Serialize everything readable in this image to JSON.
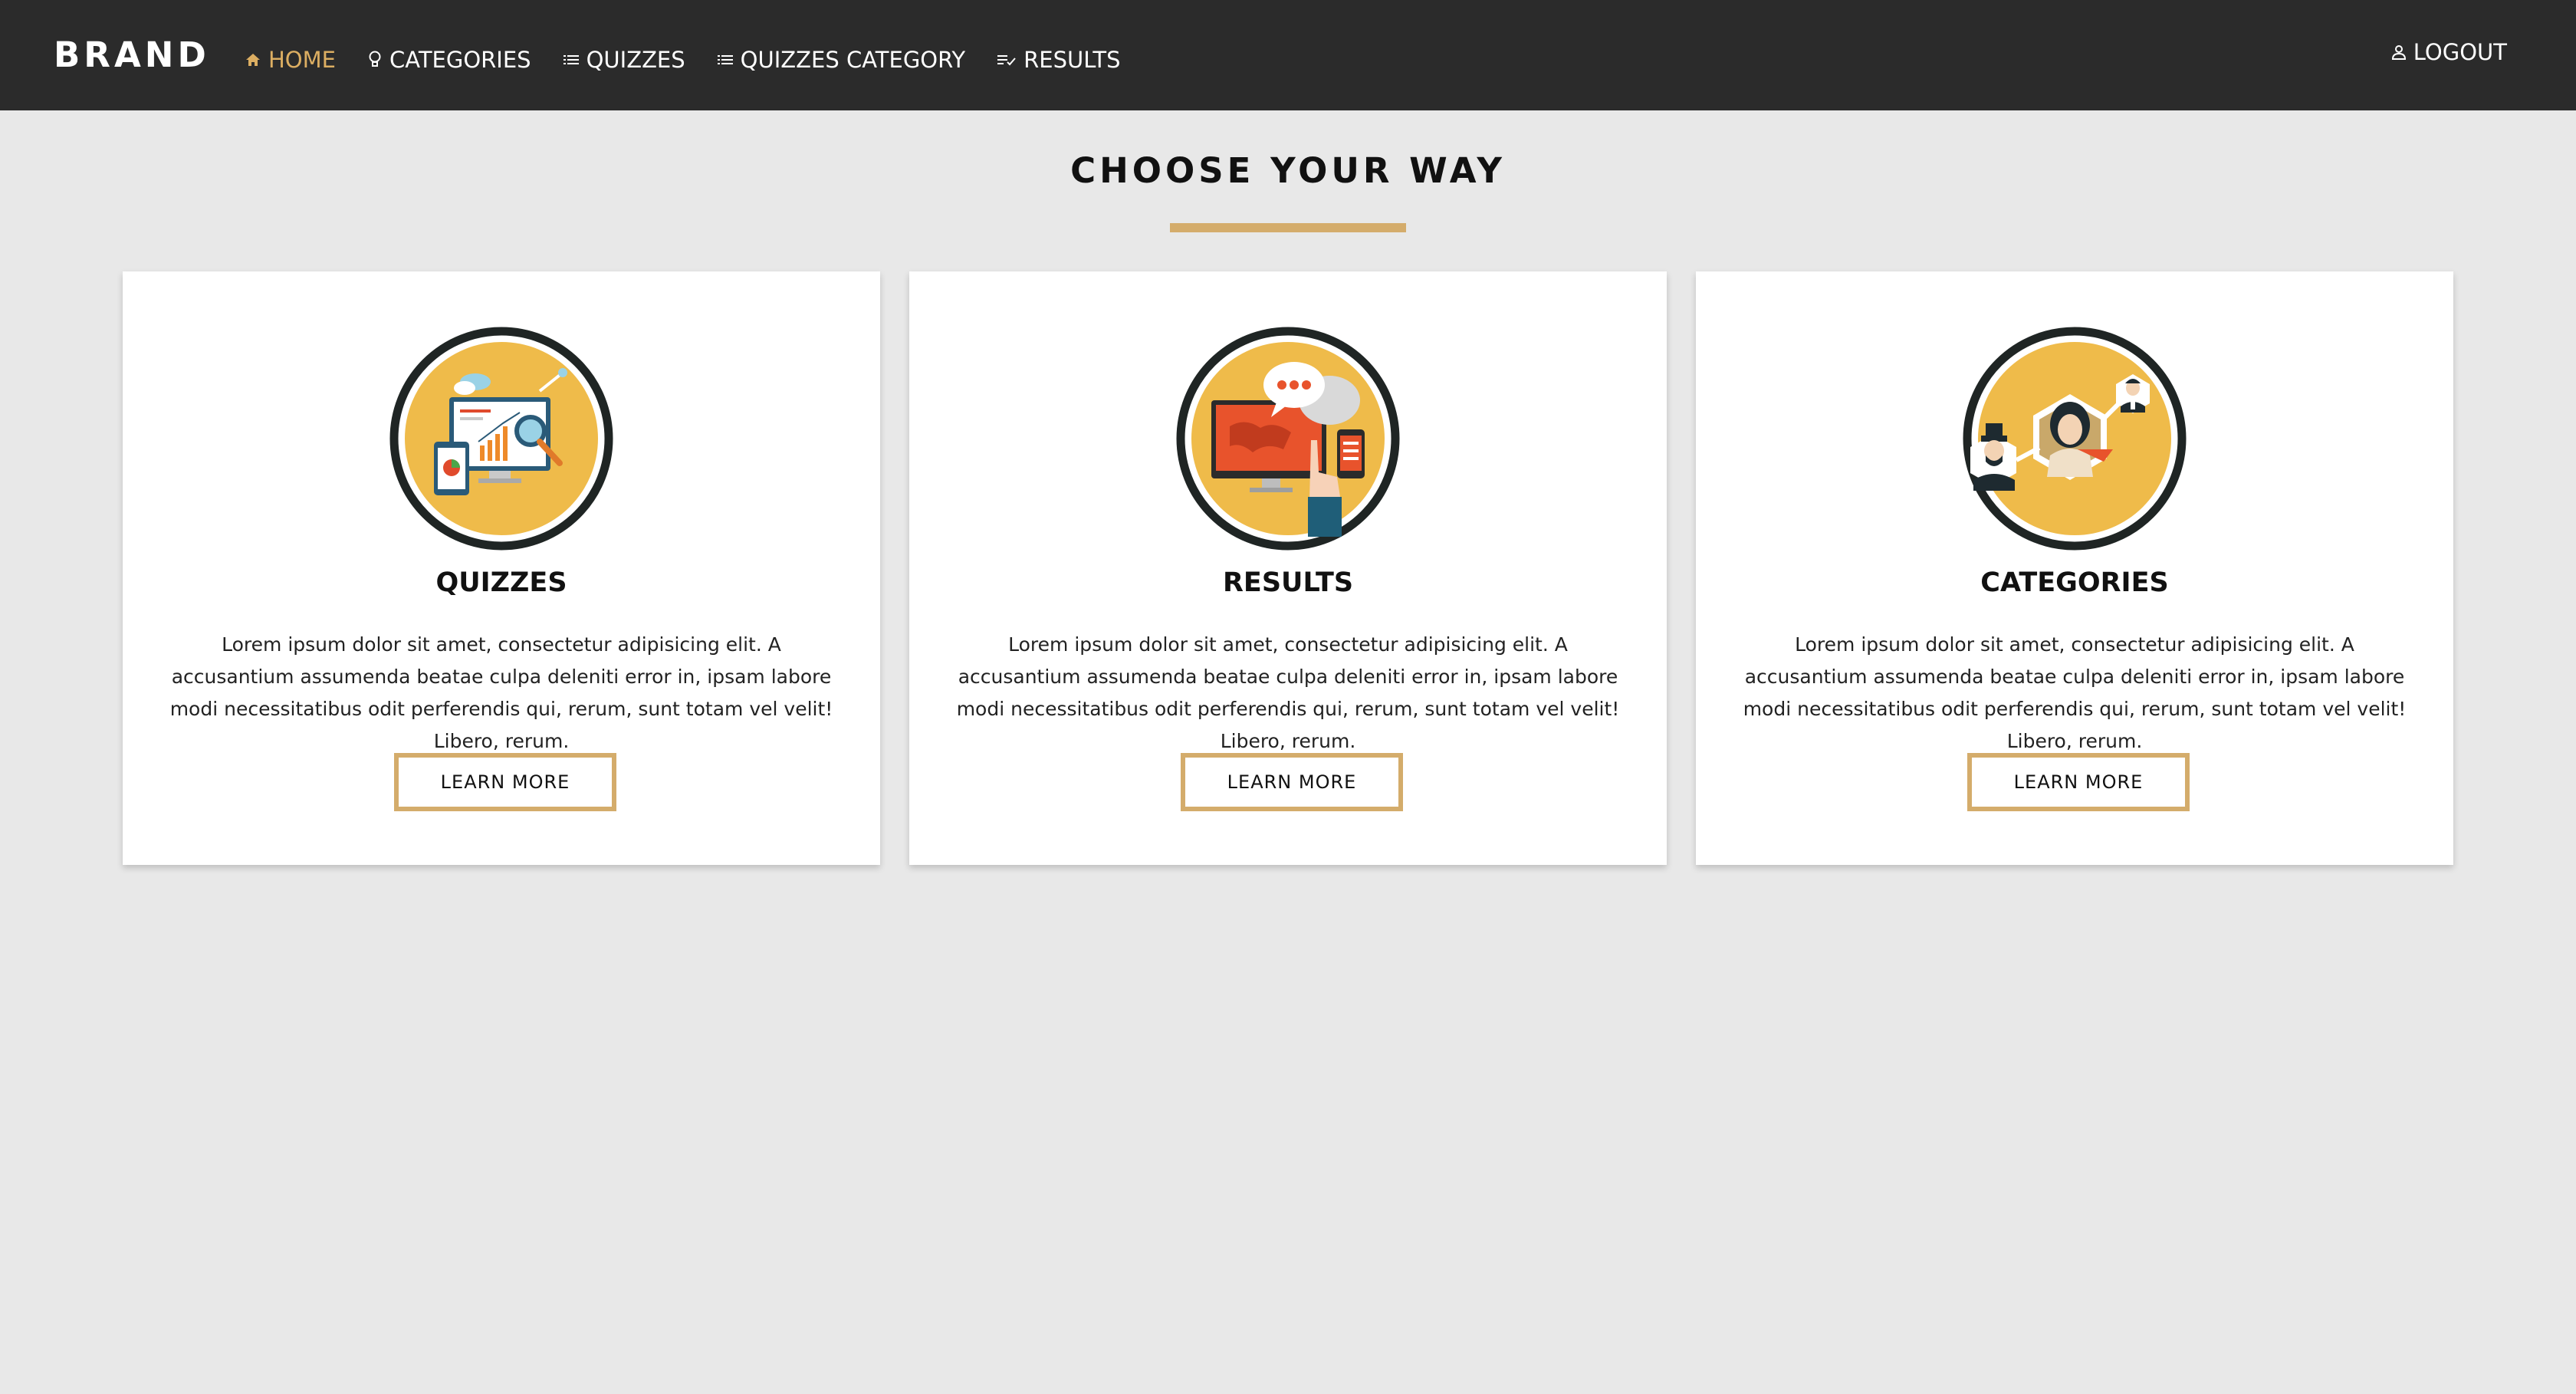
{
  "navbar": {
    "brand": "BRAND",
    "links": [
      {
        "label": "HOME",
        "icon": "home-icon",
        "active": true
      },
      {
        "label": "CATEGORIES",
        "icon": "bulb-icon",
        "active": false
      },
      {
        "label": "QUIZZES",
        "icon": "list-icon",
        "active": false
      },
      {
        "label": "QUIZZES CATEGORY",
        "icon": "list-icon",
        "active": false
      },
      {
        "label": "RESULTS",
        "icon": "checklist-icon",
        "active": false
      }
    ],
    "logout": {
      "label": "LOGOUT",
      "icon": "user-icon"
    }
  },
  "main": {
    "heading": "CHOOSE YOUR WAY",
    "cards": [
      {
        "title": "QUIZZES",
        "illustration": "analytics-illustration",
        "text": "Lorem ipsum dolor sit amet, consectetur adipisicing elit. A accusantium assumenda beatae culpa deleniti error in, ipsam labore modi necessitatibus odit perferendis qui, rerum, sunt totam vel velit! Libero, rerum.",
        "button": "LEARN MORE"
      },
      {
        "title": "RESULTS",
        "illustration": "chat-device-illustration",
        "text": "Lorem ipsum dolor sit amet, consectetur adipisicing elit. A accusantium assumenda beatae culpa deleniti error in, ipsam labore modi necessitatibus odit perferendis qui, rerum, sunt totam vel velit! Libero, rerum.",
        "button": "LEARN MORE"
      },
      {
        "title": "CATEGORIES",
        "illustration": "people-network-illustration",
        "text": "Lorem ipsum dolor sit amet, consectetur adipisicing elit. A accusantium assumenda beatae culpa deleniti error in, ipsam labore modi necessitatibus odit perferendis qui, rerum, sunt totam vel velit! Libero, rerum.",
        "button": "LEARN MORE"
      }
    ]
  },
  "colors": {
    "navbar_bg": "#2b2b2b",
    "accent": "#d4ac6b",
    "active_link": "#dcae62",
    "page_bg": "#e8e8e8",
    "icon_circle": "#efbb4a"
  }
}
